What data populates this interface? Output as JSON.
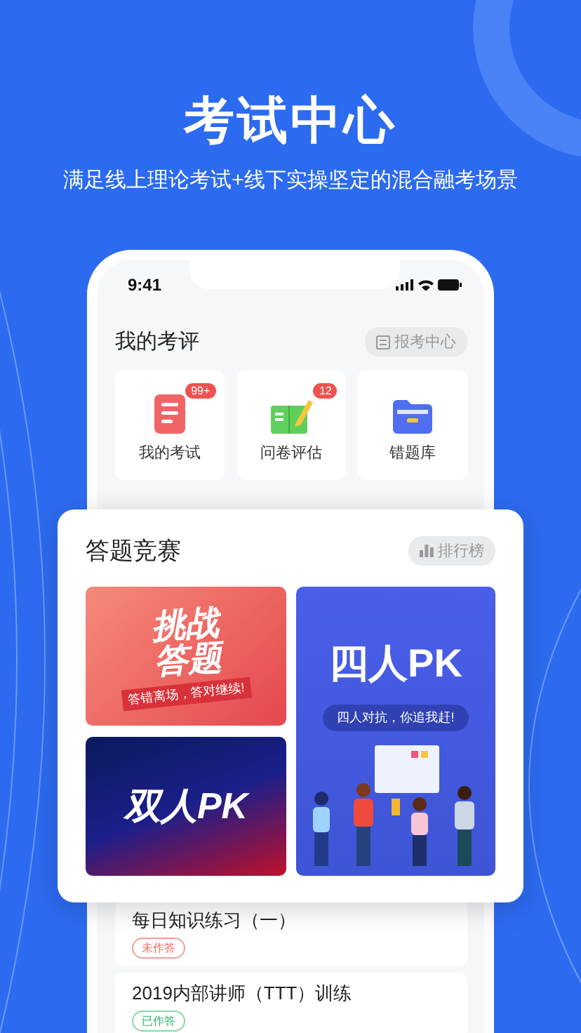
{
  "headline": "考试中心",
  "subtitle": "满足线上理论考试+线下实操坚定的混合融考场景",
  "phone": {
    "status_time": "9:41",
    "section": {
      "title": "我的考评",
      "action": "报考中心"
    },
    "tiles": [
      {
        "kind": "exam",
        "label": "我的考试",
        "badge": "99+"
      },
      {
        "kind": "survey",
        "label": "问卷评估",
        "badge": "12"
      },
      {
        "kind": "mistakes",
        "label": "错题库"
      }
    ],
    "tasks": [
      {
        "title": "每日知识练习（一）",
        "tag": "未作答",
        "kind": "pending"
      },
      {
        "title": "2019内部讲师（TTT）训练",
        "tag": "已作答",
        "kind": "done"
      }
    ]
  },
  "contest": {
    "title": "答题竞赛",
    "action": "排行榜",
    "banners": [
      {
        "kind": "challenge",
        "title": "挑战答题",
        "caption": "答错离场，答对继续!"
      },
      {
        "kind": "four",
        "title": "四人PK",
        "caption": "四人对抗，你追我赶!"
      },
      {
        "kind": "duo",
        "title": "双人PK"
      }
    ]
  }
}
